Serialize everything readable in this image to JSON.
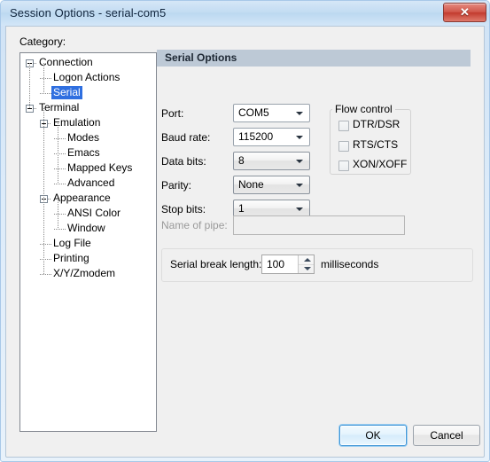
{
  "window": {
    "title": "Session Options - serial-com5",
    "close_icon": "close-icon",
    "close_glyph": "✕"
  },
  "sidebar": {
    "label": "Category:",
    "selected": "Serial",
    "items": [
      {
        "label": "Connection",
        "depth": 0,
        "expander": true,
        "selected": false
      },
      {
        "label": "Logon Actions",
        "depth": 1,
        "expander": false,
        "selected": false
      },
      {
        "label": "Serial",
        "depth": 1,
        "expander": false,
        "selected": true
      },
      {
        "label": "Terminal",
        "depth": 0,
        "expander": true,
        "selected": false
      },
      {
        "label": "Emulation",
        "depth": 1,
        "expander": true,
        "selected": false
      },
      {
        "label": "Modes",
        "depth": 2,
        "expander": false,
        "selected": false
      },
      {
        "label": "Emacs",
        "depth": 2,
        "expander": false,
        "selected": false
      },
      {
        "label": "Mapped Keys",
        "depth": 2,
        "expander": false,
        "selected": false
      },
      {
        "label": "Advanced",
        "depth": 2,
        "expander": false,
        "selected": false
      },
      {
        "label": "Appearance",
        "depth": 1,
        "expander": true,
        "selected": false
      },
      {
        "label": "ANSI Color",
        "depth": 2,
        "expander": false,
        "selected": false
      },
      {
        "label": "Window",
        "depth": 2,
        "expander": false,
        "selected": false
      },
      {
        "label": "Log File",
        "depth": 1,
        "expander": false,
        "selected": false
      },
      {
        "label": "Printing",
        "depth": 1,
        "expander": false,
        "selected": false
      },
      {
        "label": "X/Y/Zmodem",
        "depth": 1,
        "expander": false,
        "selected": false
      }
    ]
  },
  "pane": {
    "header": "Serial Options",
    "fields": {
      "port": {
        "label": "Port:",
        "value": "COM5"
      },
      "baud_rate": {
        "label": "Baud rate:",
        "value": "115200"
      },
      "data_bits": {
        "label": "Data bits:",
        "value": "8"
      },
      "parity": {
        "label": "Parity:",
        "value": "None"
      },
      "stop_bits": {
        "label": "Stop bits:",
        "value": "1"
      },
      "name_of_pipe": {
        "label": "Name of pipe:",
        "value": ""
      }
    },
    "flow_control": {
      "legend": "Flow control",
      "checkboxes": [
        {
          "label": "DTR/DSR",
          "checked": false
        },
        {
          "label": "RTS/CTS",
          "checked": false
        },
        {
          "label": "XON/XOFF",
          "checked": false
        }
      ]
    },
    "serial_break": {
      "label": "Serial break length:",
      "value": "100",
      "unit": "milliseconds"
    }
  },
  "buttons": {
    "ok": "OK",
    "cancel": "Cancel"
  },
  "colors": {
    "selection": "#2f6fe0",
    "header_band": "#bdc9d6",
    "close_red": "#c23b2e",
    "dialog_bg": "#f0f0f0"
  }
}
